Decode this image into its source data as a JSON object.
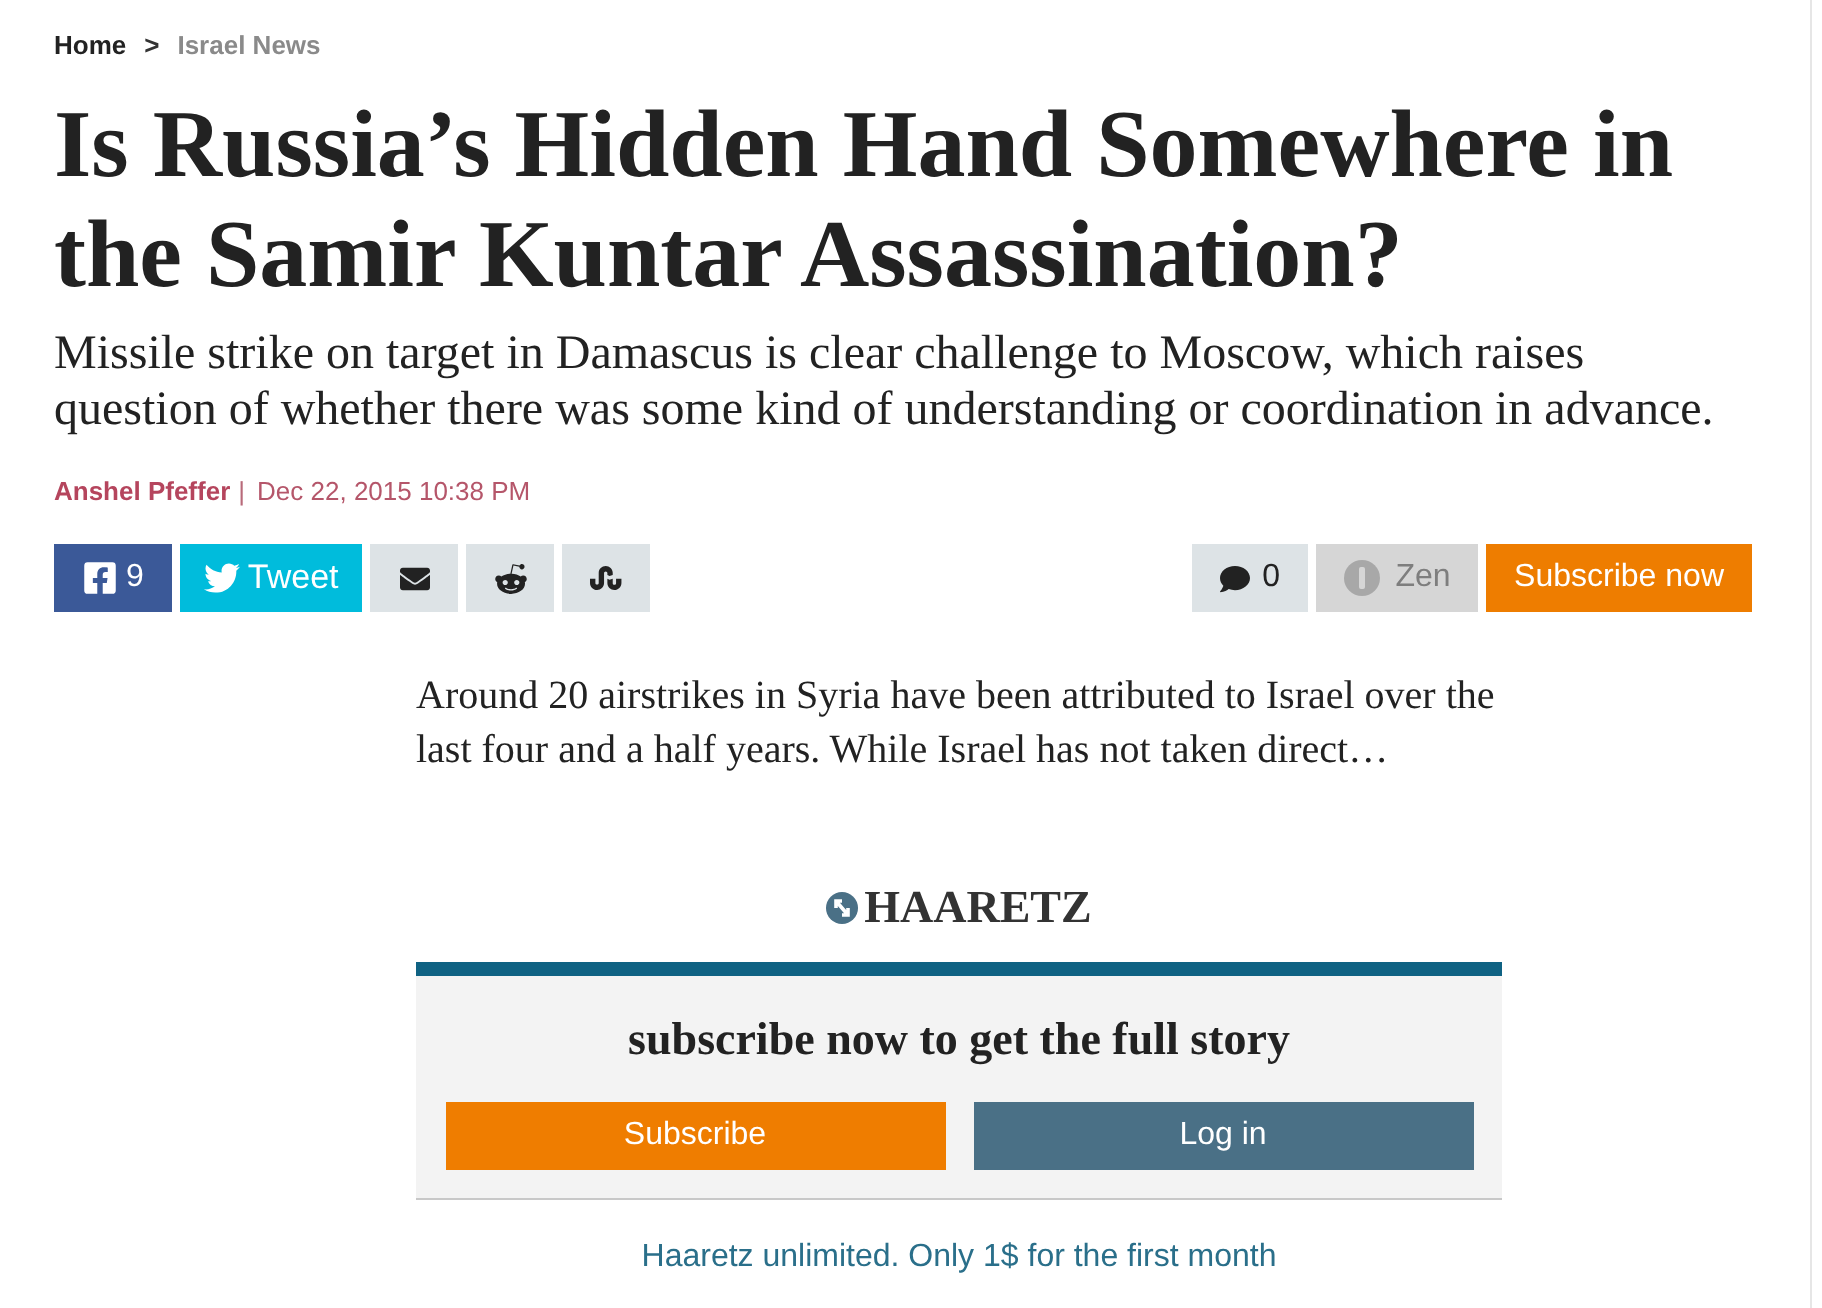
{
  "breadcrumb": {
    "separator": ">",
    "items": [
      {
        "label": "Home",
        "current": false
      },
      {
        "label": "Israel News",
        "current": true
      }
    ]
  },
  "headline": "Is Russia’s Hidden Hand Somewhere in the Samir Kuntar Assassination?",
  "subheadline": "Missile strike on target in Damascus is clear challenge to Moscow, which raises question of whether there was some kind of understanding or coordination in advance.",
  "byline": {
    "author": "Anshel Pfeffer",
    "separator": "|",
    "date": "Dec 22, 2015 10:38 PM"
  },
  "share_buttons": [
    {
      "kind": "facebook",
      "label": "9"
    },
    {
      "kind": "twitter",
      "label": "Tweet"
    },
    {
      "kind": "email"
    },
    {
      "kind": "reddit"
    },
    {
      "kind": "stumbleupon"
    }
  ],
  "actions": [
    {
      "kind": "comments",
      "label": "0"
    },
    {
      "kind": "zen",
      "label": "Zen",
      "disabled": true
    },
    {
      "kind": "subscribe",
      "label": "Subscribe now"
    }
  ],
  "teaser": "Around 20 airstrikes in Syria have been attributed to Israel over the last four and a half years. While Israel has not taken direct…",
  "paywall": {
    "logo": "HAARETZ",
    "heading": "subscribe now to get the full story",
    "buttons": [
      {
        "kind": "subscribe",
        "label": "Subscribe"
      },
      {
        "kind": "login",
        "label": "Log in"
      }
    ],
    "offer": "Haaretz unlimited. Only 1$ for the first month"
  }
}
